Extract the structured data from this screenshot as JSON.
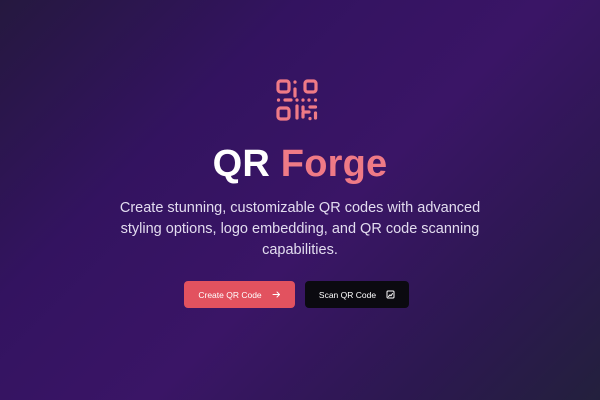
{
  "brand": {
    "title_part_1": "QR",
    "title_part_2": "Forge",
    "logo_icon": "qr-code-icon",
    "accent_color": "#ef7a86"
  },
  "hero": {
    "description": "Create stunning, customizable QR codes with advanced styling options, logo embedding, and QR code scanning capabilities."
  },
  "actions": {
    "create_label": "Create QR Code",
    "create_icon": "arrow-right-icon",
    "scan_label": "Scan QR Code",
    "scan_icon": "scan-icon"
  },
  "colors": {
    "primary_button": "#e2525f",
    "secondary_button": "#0b0a10"
  }
}
